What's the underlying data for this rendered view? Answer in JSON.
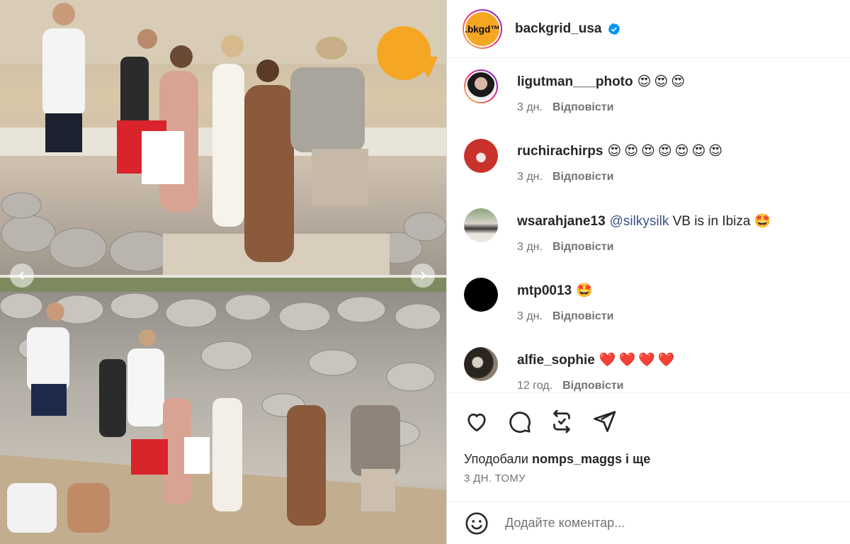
{
  "post": {
    "account": "backgrid_usa",
    "avatar_text": ".bkgd™",
    "verified": true
  },
  "comments": [
    {
      "user": "ligutman___photo",
      "text": "",
      "emoji": "😍😍😍",
      "time": "3 дн.",
      "reply": "Відповісти"
    },
    {
      "user": "ruchirachirps",
      "text": "",
      "emoji": "😍😍😍😍😍😍😍",
      "time": "3 дн.",
      "reply": "Відповісти"
    },
    {
      "user": "wsarahjane13",
      "mention": "@silkysilk",
      "text": " VB is in Ibiza ",
      "emoji": "🤩",
      "time": "3 дн.",
      "reply": "Відповісти"
    },
    {
      "user": "mtp0013",
      "text": "",
      "emoji": "🤩",
      "time": "3 дн.",
      "reply": "Відповісти"
    },
    {
      "user": "alfie_sophie",
      "text": "",
      "emoji": "❤️❤️❤️❤️",
      "time": "12 год.",
      "reply": "Відповісти"
    }
  ],
  "actions": {
    "like": "heart-icon",
    "comment": "comment-icon",
    "share": "repost-icon",
    "send": "send-icon"
  },
  "likes": {
    "prefix": "Уподобали ",
    "user": "nomps_maggs",
    "suffix": " і ще"
  },
  "posted": "3 ДН. ТОМУ",
  "add_comment": {
    "placeholder": "Додайте коментар..."
  },
  "colors": {
    "text": "#262626",
    "secondary": "#737373",
    "verified": "#0095f6",
    "mention": "#385185",
    "brand_avatar": "#f5a623"
  }
}
